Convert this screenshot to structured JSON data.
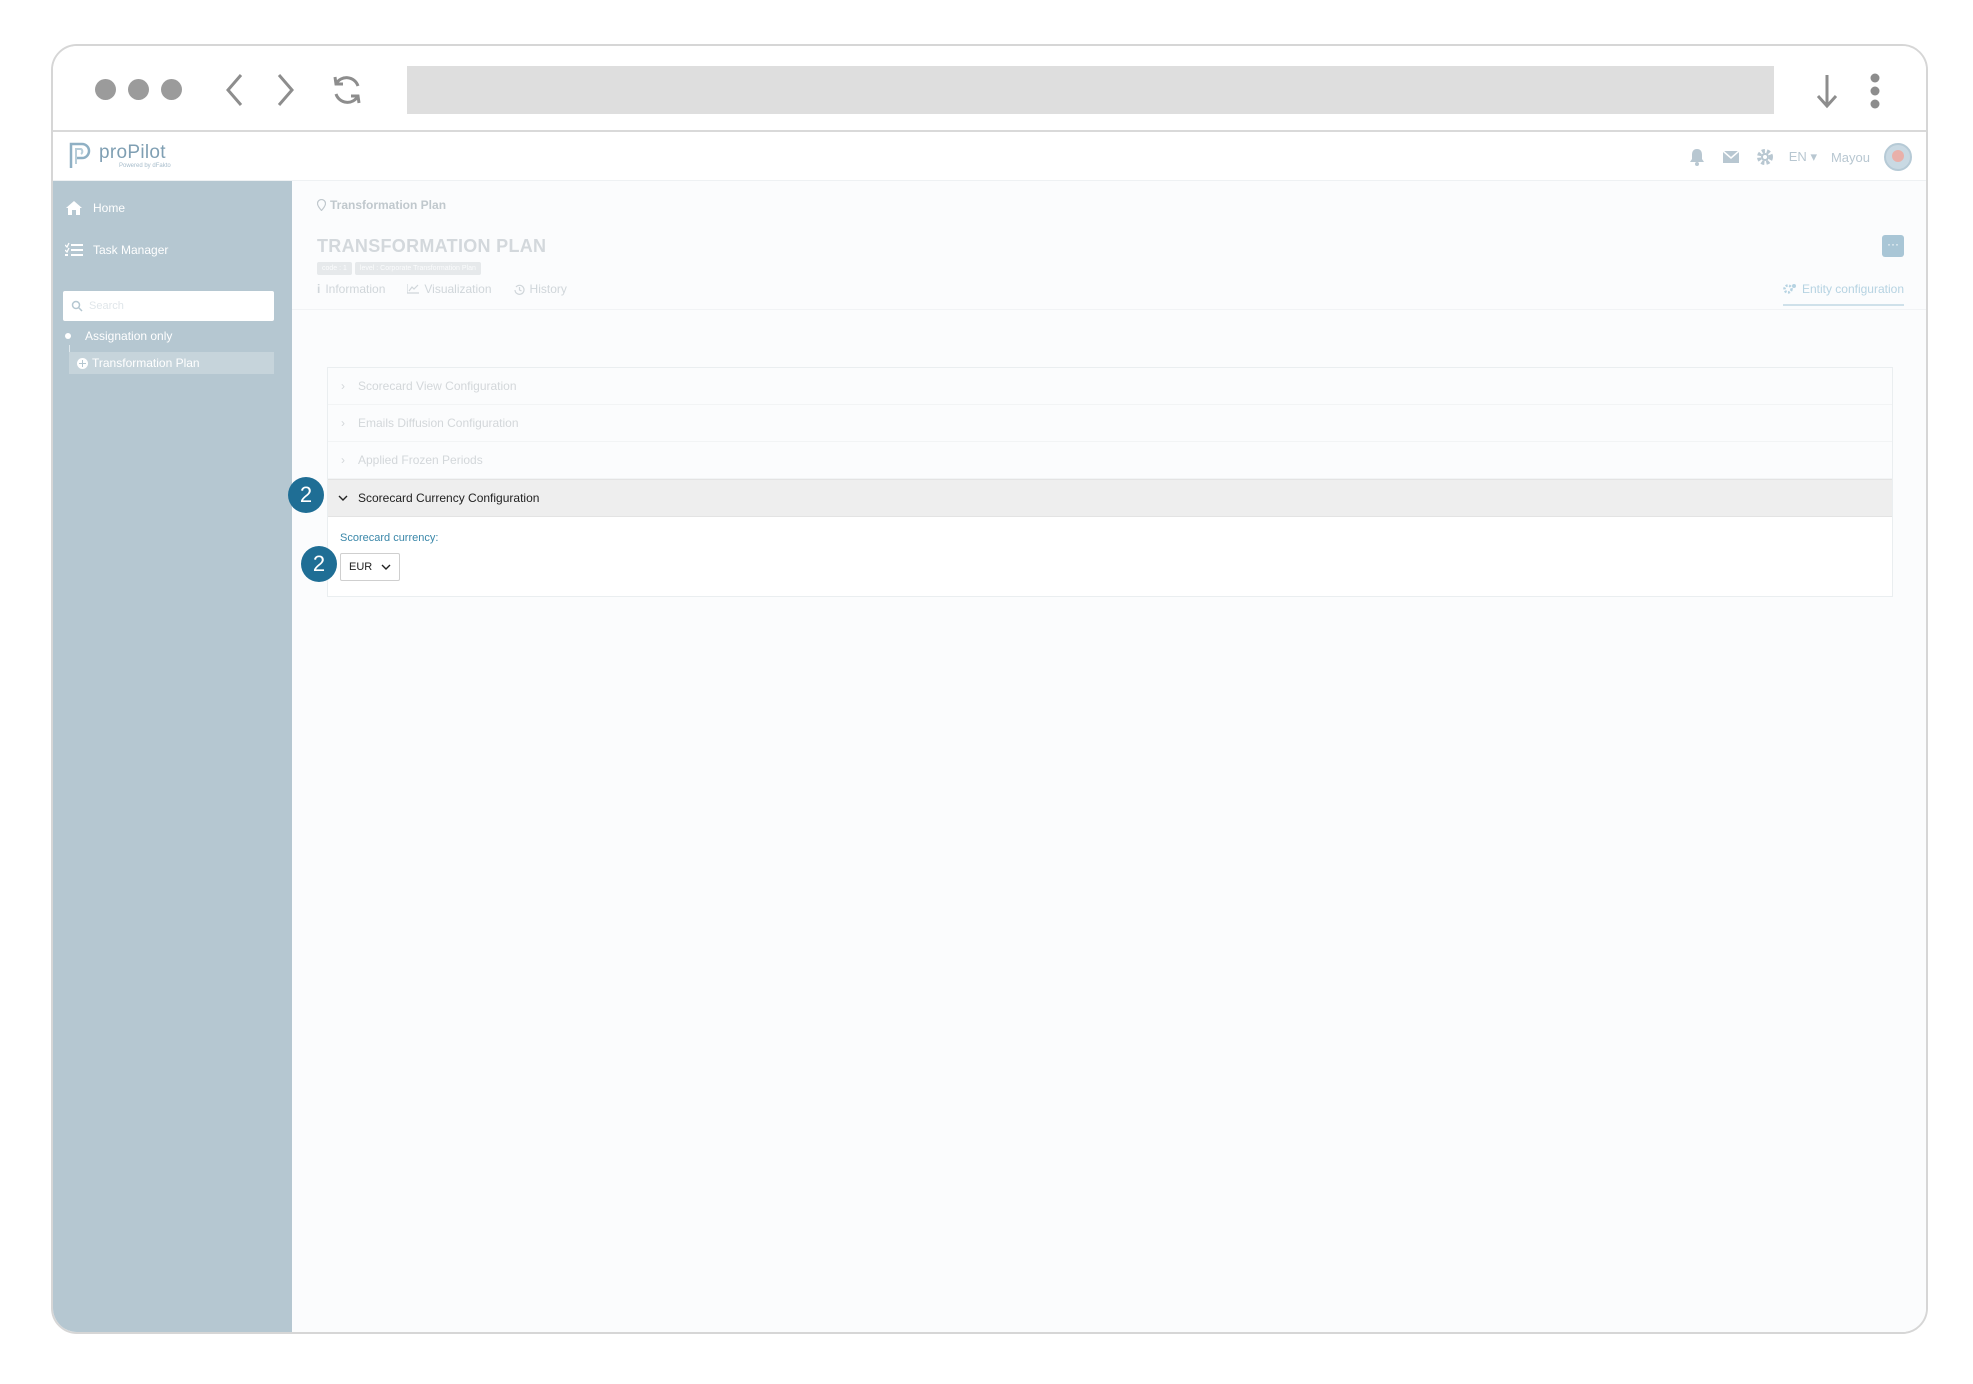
{
  "browser": {
    "controls": [
      "window-dots",
      "back",
      "forward",
      "reload",
      "download",
      "menu"
    ]
  },
  "header": {
    "logo_text": "proPilot",
    "logo_sub": "Powered by dFakto",
    "lang": "EN",
    "user": "Mayou"
  },
  "sidebar": {
    "home": "Home",
    "task_manager": "Task Manager",
    "search_placeholder": "Search",
    "assignation": "Assignation only",
    "tree_item": "Transformation Plan"
  },
  "main": {
    "breadcrumb": "Transformation Plan",
    "title": "TRANSFORMATION PLAN",
    "badges": [
      "code : 1",
      "level : Corporate Transformation Plan"
    ],
    "more_button": "···",
    "tabs": [
      "Information",
      "Visualization",
      "History"
    ],
    "active_tab": "Entity configuration",
    "sections": [
      "Scorecard View Configuration",
      "Emails Diffusion Configuration",
      "Applied Frozen Periods",
      "Scorecard Currency Configuration"
    ],
    "currency_label": "Scorecard currency:",
    "currency_value": "EUR"
  },
  "markers": [
    "2",
    "2"
  ],
  "colors": {
    "sidebar": "#b5c7d1",
    "marker": "#1f6e95",
    "accent": "#3a87a9"
  }
}
